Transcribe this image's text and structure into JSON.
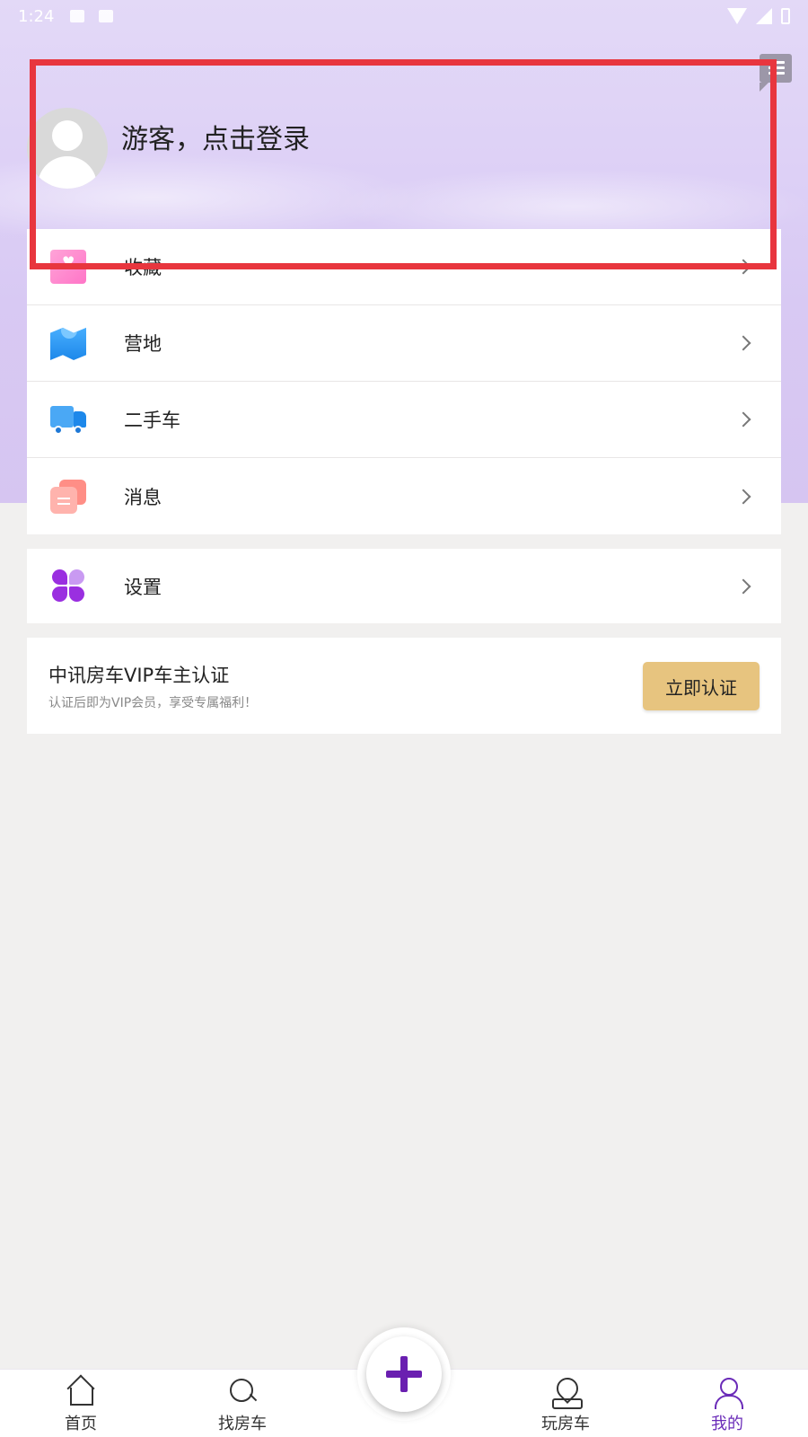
{
  "status_bar": {
    "time": "1:24"
  },
  "profile": {
    "login_text": "游客，点击登录"
  },
  "menu": {
    "items": [
      {
        "label": "收藏",
        "icon": "favorite-heart-icon"
      },
      {
        "label": "营地",
        "icon": "campsite-map-icon"
      },
      {
        "label": "二手车",
        "icon": "truck-icon"
      },
      {
        "label": "消息",
        "icon": "message-icon"
      }
    ],
    "settings": {
      "label": "设置",
      "icon": "settings-clover-icon"
    }
  },
  "vip": {
    "title": "中讯房车VIP车主认证",
    "subtitle": "认证后即为VIP会员，享受专属福利！",
    "button": "立即认证"
  },
  "bottom_nav": {
    "items": [
      {
        "label": "首页",
        "icon": "home-icon"
      },
      {
        "label": "找房车",
        "icon": "search-icon"
      },
      {
        "label": "玩房车",
        "icon": "map-pin-icon"
      },
      {
        "label": "我的",
        "icon": "user-icon",
        "active": true
      }
    ]
  },
  "colors": {
    "accent": "#6a2bb8",
    "vip_button": "#e7c47f",
    "highlight": "#e8363e"
  }
}
